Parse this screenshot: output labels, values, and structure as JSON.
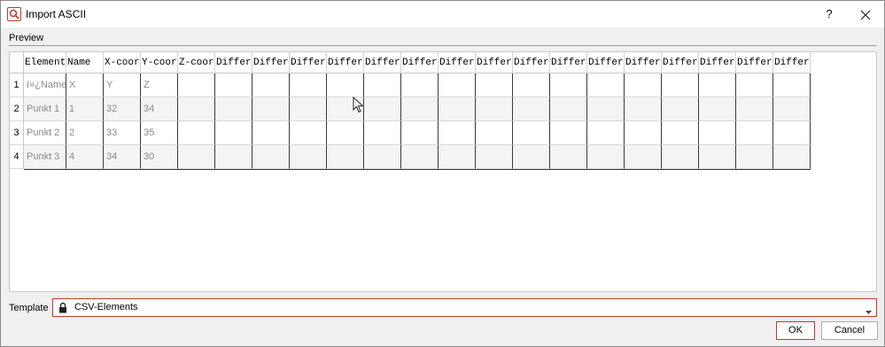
{
  "window": {
    "title": "Import ASCII",
    "help_label": "?",
    "close_label": "✕"
  },
  "preview": {
    "label": "Preview",
    "columns": [
      "Element",
      "Name",
      "X-coor",
      "Y-coor",
      "Z-coor",
      "Differe",
      "Differe",
      "Differe",
      "Differe",
      "Differe",
      "Differe",
      "Differe",
      "Differe",
      "Differe",
      "Differe",
      "Differe",
      "Differe",
      "Differe",
      "Differe",
      "Differe",
      "Differe"
    ],
    "rows": [
      {
        "num": "1",
        "cells": [
          "ï»¿Name",
          "X",
          "Y",
          "Z"
        ]
      },
      {
        "num": "2",
        "cells": [
          "Punkt 1",
          "1",
          "32",
          "34"
        ]
      },
      {
        "num": "3",
        "cells": [
          "Punkt 2",
          "2",
          "33",
          "35"
        ]
      },
      {
        "num": "4",
        "cells": [
          "Punkt 3",
          "4",
          "34",
          "30"
        ]
      }
    ]
  },
  "template": {
    "label": "Template",
    "value": "CSV-Elements",
    "icon": "lock-icon"
  },
  "buttons": {
    "ok": "OK",
    "cancel": "Cancel"
  },
  "colors": {
    "accent": "#c0392b",
    "grid_line": "#3a3a3a"
  }
}
